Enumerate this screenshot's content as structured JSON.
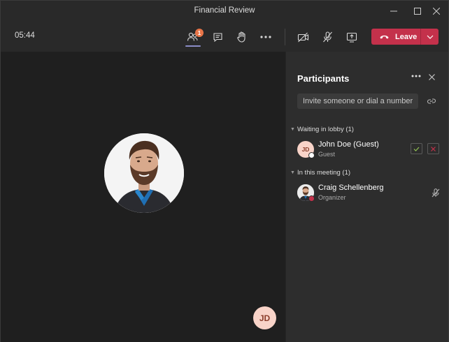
{
  "window": {
    "title": "Financial Review"
  },
  "toolbar": {
    "timer": "05:44",
    "participants_count": "1",
    "leave_label": "Leave"
  },
  "stage": {
    "main_participant": "Craig Schellenberg",
    "self_initials": "JD"
  },
  "panel": {
    "title": "Participants",
    "invite_placeholder": "Invite someone or dial a number",
    "lobby_section": "Waiting in lobby (1)",
    "meeting_section": "In this meeting (1)",
    "lobby": [
      {
        "initials": "JD",
        "name": "John Doe (Guest)",
        "role": "Guest",
        "status": "away"
      }
    ],
    "meeting": [
      {
        "name": "Craig Schellenberg",
        "role": "Organizer",
        "status": "busy",
        "muted": true
      }
    ]
  },
  "colors": {
    "accent": "#8b8cc7",
    "leave": "#c4314b",
    "badge": "#e97548",
    "admit": "#92c353",
    "deny": "#c4314b"
  },
  "icons": {
    "participants": "people-icon",
    "chat": "chat-icon",
    "raise_hand": "hand-icon",
    "more": "more-icon",
    "camera": "camera-off-icon",
    "mic": "mic-off-icon",
    "share": "share-screen-icon",
    "leave": "phone-hangup-icon"
  }
}
